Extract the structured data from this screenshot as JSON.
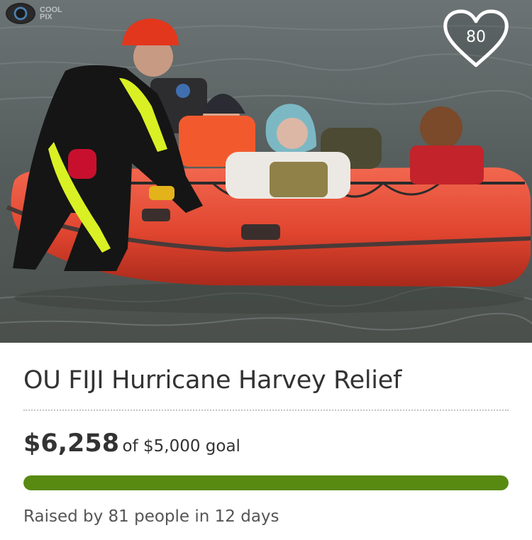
{
  "campaign": {
    "title": "OU FIJI Hurricane Harvey Relief",
    "amount_raised": "$6,258",
    "goal_text": "of $5,000 goal",
    "progress_fraction": 1.0,
    "raised_by_text": "Raised by 81 people in 12 days"
  },
  "photo": {
    "subject": "flood rescue inflatable boat",
    "watermark_text": "COOL PIX"
  },
  "heart": {
    "count": "80",
    "icon": "heart-outline-icon"
  },
  "colors": {
    "progress_fill": "#588a12",
    "progress_track": "#e3e3e3",
    "text_primary": "#333333",
    "text_secondary": "#555555"
  }
}
